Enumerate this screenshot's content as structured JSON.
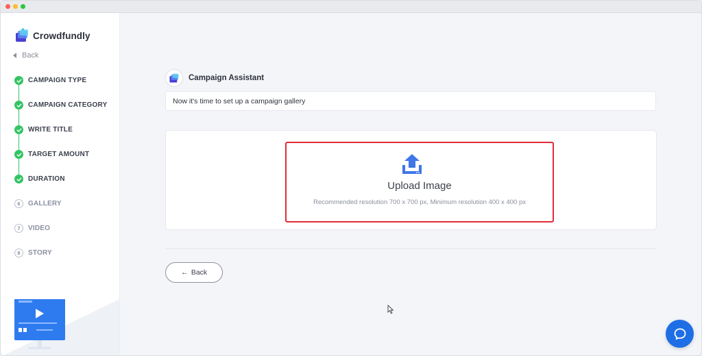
{
  "brand": {
    "name": "Crowdfundly"
  },
  "sidebar": {
    "back_label": "Back",
    "steps": [
      {
        "label": "CAMPAIGN TYPE",
        "status": "done"
      },
      {
        "label": "CAMPAIGN CATEGORY",
        "status": "done"
      },
      {
        "label": "WRITE TITLE",
        "status": "done"
      },
      {
        "label": "TARGET AMOUNT",
        "status": "done"
      },
      {
        "label": "DURATION",
        "status": "done"
      },
      {
        "label": "GALLERY",
        "status": "todo",
        "number": "6"
      },
      {
        "label": "VIDEO",
        "status": "todo",
        "number": "7"
      },
      {
        "label": "STORY",
        "status": "todo",
        "number": "8"
      }
    ]
  },
  "assistant": {
    "name": "Campaign Assistant",
    "message": "Now it's time to set up a campaign gallery"
  },
  "upload": {
    "title": "Upload Image",
    "hint": "Recommended resolution 700 x 700 px, Minimum resolution 400 x 400 px"
  },
  "footer": {
    "back_button": "Back"
  },
  "colors": {
    "accent": "#1e6fe6",
    "step_done": "#34c465",
    "highlight": "#e12b38",
    "upload_icon": "#3f76e8"
  },
  "icons": {
    "brand": "crowdfundly-logo-icon",
    "back": "caret-left-icon",
    "step_done": "check-circle-icon",
    "upload": "upload-tray-icon",
    "back_button": "arrow-left-icon",
    "chat": "chat-bubble-icon",
    "promo": "video-monitor-icon"
  }
}
